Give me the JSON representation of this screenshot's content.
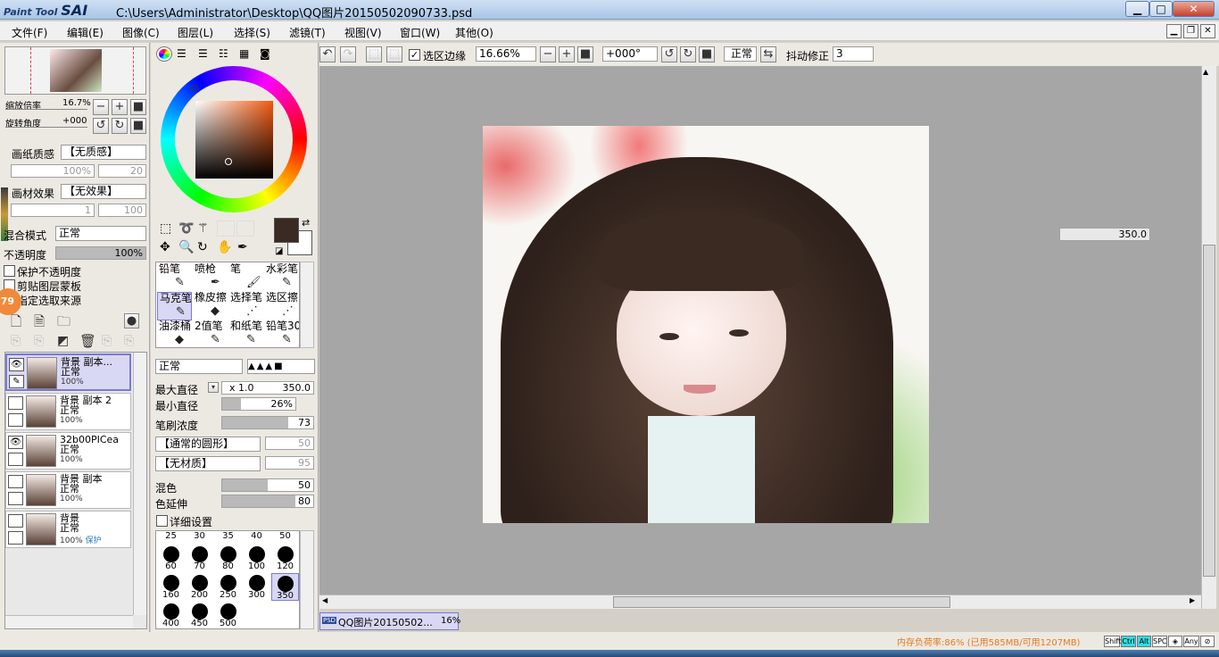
{
  "window": {
    "app_logo": "Paint Tool",
    "app_logo_brand": "SAI",
    "title": "C:\\Users\\Administrator\\Desktop\\QQ图片20150502090733.psd",
    "min": "▁",
    "max": "□",
    "close": "✕"
  },
  "menu": [
    "文件(F)",
    "编辑(E)",
    "图像(C)",
    "图层(L)",
    "选择(S)",
    "滤镜(T)",
    "视图(V)",
    "窗口(W)",
    "其他(O)"
  ],
  "navigator": {
    "zoom_label": "缩放倍率",
    "zoom_value": "16.7%",
    "rotate_label": "旋转角度",
    "rotate_value": "+000"
  },
  "paper": {
    "texture_label": "画纸质感",
    "texture_value": "【无质感】",
    "texture_scale_label": "倍率",
    "texture_scale_value": "100%",
    "texture_strength_label": "强度",
    "texture_strength_value": "20",
    "effect_label": "画材效果",
    "effect_value": "【无效果】",
    "effect_degree_label": "程度",
    "effect_degree_value": "1",
    "effect_strength_label": "强度",
    "effect_strength_value": "100"
  },
  "blend": {
    "mode_label": "混合模式",
    "mode_value": "正常",
    "opacity_label": "不透明度",
    "opacity_value": "100%",
    "opacity_fraction": 1.0
  },
  "layer_options": [
    "保护不透明度",
    "剪贴图层蒙板",
    "指定选取来源"
  ],
  "badge": "79",
  "layers": [
    {
      "name": "背景 副本...",
      "mode": "正常",
      "opacity": "100%",
      "protect": "",
      "visible": true,
      "selected": true
    },
    {
      "name": "背景 副本 2",
      "mode": "正常",
      "opacity": "100%",
      "protect": "",
      "visible": false,
      "selected": false
    },
    {
      "name": "32b00PICea",
      "mode": "正常",
      "opacity": "100%",
      "protect": "",
      "visible": true,
      "selected": false
    },
    {
      "name": "背景 副本",
      "mode": "正常",
      "opacity": "100%",
      "protect": "",
      "visible": false,
      "selected": false
    },
    {
      "name": "背景",
      "mode": "正常",
      "opacity": "100%",
      "protect": "保护",
      "visible": false,
      "selected": false
    }
  ],
  "colors": {
    "primary": "#3a2a22",
    "secondary": "#ffffff",
    "accent": "#7a78d8"
  },
  "tools": [
    {
      "label": "铅笔",
      "icon": "✎"
    },
    {
      "label": "喷枪",
      "icon": "✒"
    },
    {
      "label": "笔",
      "icon": "🖌"
    },
    {
      "label": "水彩笔",
      "icon": "✎"
    },
    {
      "label": "马克笔",
      "icon": "✎",
      "selected": true
    },
    {
      "label": "橡皮擦",
      "icon": "◆"
    },
    {
      "label": "选择笔",
      "icon": "⋰"
    },
    {
      "label": "选区擦",
      "icon": "⋰"
    },
    {
      "label": "油漆桶",
      "icon": "◆"
    },
    {
      "label": "2值笔",
      "icon": "✎"
    },
    {
      "label": "和纸笔",
      "icon": "✎"
    },
    {
      "label": "铅笔30",
      "icon": "✎"
    }
  ],
  "brush": {
    "mode": "正常",
    "max_size_label": "最大直径",
    "max_size_mult": "x 1.0",
    "max_size_value": "350.0",
    "min_size_label": "最小直径",
    "min_size_value": "26%",
    "min_size_fraction": 0.26,
    "density_label": "笔刷浓度",
    "density_value": "73",
    "density_fraction": 0.73,
    "shape": "【通常的圆形】",
    "shape_strength_label": "强度",
    "shape_strength_value": "50",
    "texture": "【无材质】",
    "texture_strength_label": "强度",
    "texture_strength_value": "95",
    "blend_label": "混色",
    "blend_value": "50",
    "blend_fraction": 0.5,
    "persist_label": "色延伸",
    "persist_value": "80",
    "persist_fraction": 0.8,
    "detail_label": "详细设置"
  },
  "brush_sizes_top": [
    "25",
    "30",
    "35",
    "40",
    "50"
  ],
  "brush_sizes": [
    "60",
    "70",
    "80",
    "100",
    "120",
    "160",
    "200",
    "250",
    "300",
    "350",
    "400",
    "450",
    "500"
  ],
  "toolbar": {
    "sel_edge_label": "选区边缘",
    "zoom": "16.66%",
    "angle": "+000°",
    "mode": "正常",
    "stabilizer_label": "抖动修正",
    "stabilizer_value": "3"
  },
  "canvas": {
    "size_readout": "350.0"
  },
  "doc_tab": {
    "type": "PSD",
    "name": "QQ图片20150502...",
    "zoom": "16%"
  },
  "status": {
    "memory": "内存负荷率:86% (已用585MB/可用1207MB)",
    "keys": [
      "Shift",
      "Ctrl",
      "Alt",
      "SPC",
      "◈",
      "Any",
      "⊘"
    ]
  }
}
